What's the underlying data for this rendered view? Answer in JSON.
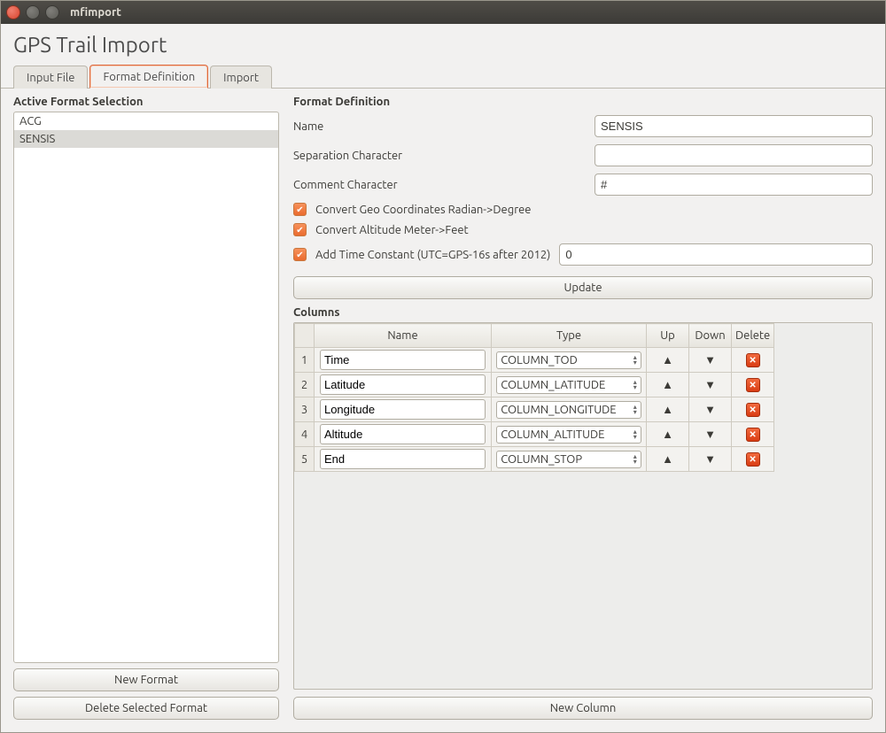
{
  "window": {
    "title": "mfimport"
  },
  "page": {
    "title": "GPS Trail Import"
  },
  "tabs": {
    "input_file": "Input File",
    "format_definition": "Format Definition",
    "import": "Import",
    "active": "format_definition"
  },
  "left": {
    "heading": "Active Format Selection",
    "formats": [
      "ACG",
      "SENSIS"
    ],
    "selected": "SENSIS",
    "new_format_btn": "New Format",
    "delete_format_btn": "Delete Selected Format"
  },
  "right": {
    "heading": "Format Definition",
    "name_label": "Name",
    "name_value": "SENSIS",
    "sep_label": "Separation Character",
    "sep_value": "",
    "comment_label": "Comment Character",
    "comment_value": "#",
    "cb_geo_label": "Convert Geo Coordinates Radian->Degree",
    "cb_alt_label": "Convert Altitude Meter->Feet",
    "cb_time_label": "Add Time Constant (UTC=GPS-16s after 2012)",
    "time_value": "0",
    "update_btn": "Update",
    "columns_label": "Columns",
    "headers": {
      "name": "Name",
      "type": "Type",
      "up": "Up",
      "down": "Down",
      "delete": "Delete"
    },
    "columns": [
      {
        "idx": "1",
        "name": "Time",
        "type": "COLUMN_TOD"
      },
      {
        "idx": "2",
        "name": "Latitude",
        "type": "COLUMN_LATITUDE"
      },
      {
        "idx": "3",
        "name": "Longitude",
        "type": "COLUMN_LONGITUDE"
      },
      {
        "idx": "4",
        "name": "Altitude",
        "type": "COLUMN_ALTITUDE"
      },
      {
        "idx": "5",
        "name": "End",
        "type": "COLUMN_STOP"
      }
    ],
    "new_column_btn": "New Column"
  }
}
